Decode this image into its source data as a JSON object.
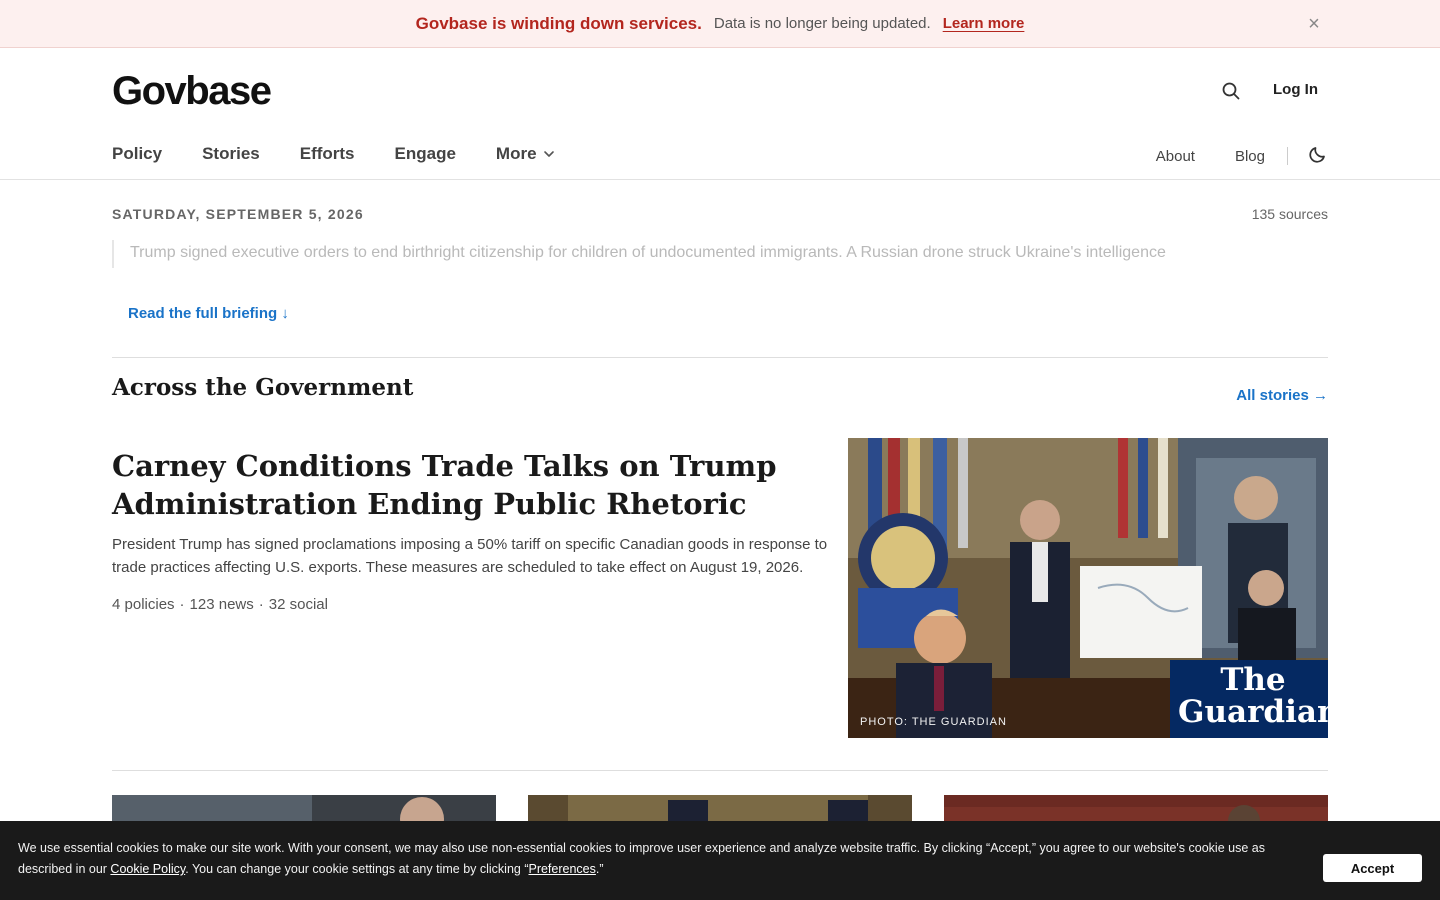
{
  "banner": {
    "headline": "Govbase is winding down services.",
    "message": "Data is no longer being updated.",
    "link_label": "Learn more",
    "close_icon": "close-icon"
  },
  "header": {
    "logo": "Govbase",
    "search_icon": "search-icon",
    "login_label": "Log In"
  },
  "nav": {
    "items": [
      "Policy",
      "Stories",
      "Efforts",
      "Engage",
      "More"
    ],
    "more_icon": "chevron-down-icon",
    "right": [
      "About",
      "Blog"
    ],
    "theme_icon": "moon-icon"
  },
  "briefing": {
    "date": "SATURDAY, SEPTEMBER 5, 2026",
    "sources": "135 sources",
    "text": "Trump signed executive orders to end birthright citizenship for children of undocumented immigrants. A Russian drone struck Ukraine's intelligence",
    "read_more": "Read the full briefing ↓"
  },
  "section": {
    "title": "Across the Government",
    "all_link": "All stories →"
  },
  "featured": {
    "title": "Carney Conditions Trade Talks on Trump Administration Ending Public Rhetoric",
    "summary": "President Trump has signed proclamations imposing a 50% tariff on specific Canadian goods in response to trade practices affecting U.S. exports. These measures are scheduled to take effect on August 19, 2026.",
    "meta": [
      "4 policies",
      "123 news",
      "32 social"
    ],
    "meta_sep": "·",
    "photo_credit": "PHOTO: THE GUARDIAN",
    "watermark": "The Guardian"
  },
  "cookie": {
    "text_1": "We use essential cookies to make our site work. With your consent, we may also use non-essential cookies to improve user experience and analyze website traffic. By clicking “Accept,” you agree to our website's cookie use as described in our ",
    "policy_link": "Cookie Policy",
    "text_2": ". You can change your cookie settings at any time by clicking “",
    "prefs_link": "Preferences",
    "text_3": ".”",
    "accept_label": "Accept"
  }
}
